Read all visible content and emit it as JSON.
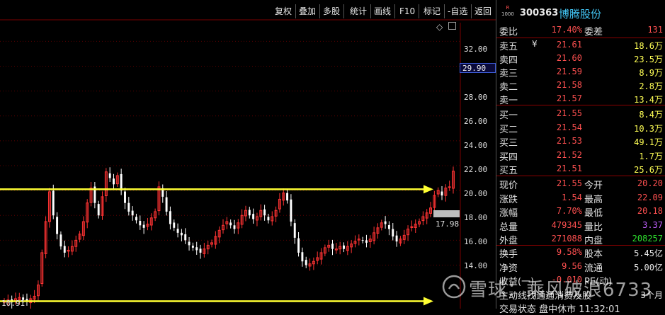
{
  "toolbar": {
    "buttons": [
      "复权",
      "叠加",
      "多股",
      "统计",
      "画线",
      "F10",
      "标记",
      "-自选",
      "返回"
    ]
  },
  "chart": {
    "y_axis_ticks": [
      "32.00",
      "30.00",
      "28.00",
      "26.00",
      "24.00",
      "22.00",
      "20.00",
      "18.00",
      "16.00",
      "14.00"
    ],
    "current_price_tag": "29.90",
    "low_marker": "17.98",
    "min_price_marker": "10.91",
    "colors": {
      "up": "#ff3333",
      "down": "#ffffff",
      "line": "#ffff33",
      "grid": "#5a0000"
    }
  },
  "chart_data": {
    "type": "candlestick",
    "ylim": [
      10.5,
      33.5
    ],
    "close": [
      11.1,
      11.2,
      11.0,
      11.3,
      11.4,
      11.2,
      11.1,
      11.3,
      11.5,
      12.4,
      15.0,
      17.5,
      19.9,
      18.0,
      16.5,
      15.5,
      15.0,
      15.2,
      15.5,
      16.0,
      16.5,
      17.5,
      19.0,
      20.2,
      19.0,
      18.0,
      19.5,
      21.5,
      21.0,
      20.5,
      21.2,
      20.0,
      19.0,
      18.3,
      18.0,
      17.6,
      17.2,
      17.0,
      17.3,
      17.8,
      18.3,
      20.3,
      19.5,
      18.3,
      17.3,
      17.0,
      16.6,
      16.4,
      16.0,
      15.6,
      15.4,
      15.2,
      15.0,
      15.3,
      15.6,
      15.8,
      16.3,
      16.8,
      17.2,
      17.5,
      17.2,
      16.9,
      17.4,
      18.0,
      18.4,
      18.0,
      17.7,
      17.9,
      18.4,
      18.0,
      17.6,
      17.9,
      18.4,
      19.3,
      19.8,
      19.2,
      17.5,
      16.2,
      15.0,
      14.3,
      14.0,
      14.1,
      14.3,
      14.6,
      15.0,
      15.4,
      15.6,
      15.3,
      15.3,
      15.5,
      15.3,
      15.5,
      15.7,
      15.9,
      16.1,
      16.0,
      15.8,
      16.1,
      16.6,
      17.0,
      17.4,
      17.3,
      16.9,
      16.3,
      15.9,
      16.1,
      16.4,
      16.9,
      17.1,
      17.3,
      17.5,
      17.9,
      18.2,
      18.6,
      19.6,
      20.0,
      19.6,
      20.2,
      20.3,
      21.55
    ],
    "min_marker": "10.91",
    "horizontal_lines": [
      20.1,
      11.1
    ]
  },
  "quote": {
    "badge_top": "R",
    "badge_bottom": "1000",
    "code": "300363",
    "name": "博腾股份",
    "weibi_label": "委比",
    "weibi_value": "17.40%",
    "weicha_label": "委差",
    "weicha_value": "131",
    "sells": [
      {
        "label": "卖五",
        "mark": "¥",
        "price": "21.61",
        "vol": "18.6万"
      },
      {
        "label": "卖四",
        "mark": "",
        "price": "21.60",
        "vol": "23.5万"
      },
      {
        "label": "卖三",
        "mark": "",
        "price": "21.59",
        "vol": "8.9万"
      },
      {
        "label": "卖二",
        "mark": "",
        "price": "21.58",
        "vol": "2.8万"
      },
      {
        "label": "卖一",
        "mark": "",
        "price": "21.57",
        "vol": "13.4万"
      }
    ],
    "buys": [
      {
        "label": "买一",
        "price": "21.55",
        "vol": "8.4万"
      },
      {
        "label": "买二",
        "price": "21.54",
        "vol": "10.3万"
      },
      {
        "label": "买三",
        "price": "21.53",
        "vol": "49.1万"
      },
      {
        "label": "买四",
        "price": "21.52",
        "vol": "1.7万"
      },
      {
        "label": "买五",
        "price": "21.51",
        "vol": "25.6万"
      }
    ],
    "stats": [
      {
        "l1": "现价",
        "v1": "21.55",
        "c1": "red",
        "l2": "今开",
        "v2": "20.20",
        "c2": "red"
      },
      {
        "l1": "涨跌",
        "v1": "1.54",
        "c1": "red",
        "l2": "最高",
        "v2": "22.09",
        "c2": "red"
      },
      {
        "l1": "涨幅",
        "v1": "7.70%",
        "c1": "red",
        "l2": "最低",
        "v2": "20.18",
        "c2": "red"
      },
      {
        "l1": "总量",
        "v1": "479345",
        "c1": "yel",
        "l2": "量比",
        "v2": "3.37",
        "c2": "pur"
      },
      {
        "l1": "外盘",
        "v1": "271088",
        "c1": "red",
        "l2": "内盘",
        "v2": "208257",
        "c2": "grn"
      }
    ],
    "stats2": [
      {
        "l1": "换手",
        "v1": "9.58%",
        "c1": "wht",
        "l2": "股本",
        "v2": "5.45亿",
        "c2": "wht"
      },
      {
        "l1": "净资",
        "v1": "9.56",
        "c1": "wht",
        "l2": "流通",
        "v2": "5.00亿",
        "c2": "wht"
      },
      {
        "l1": "收益(一)",
        "v1": "-0.010",
        "c1": "wht",
        "l2": "PE(动)",
        "v2": "",
        "c2": "wht"
      }
    ],
    "bottom_line": "主动线找通通消费及股",
    "bottom_month": "3个月",
    "status_line": "交易状态  盘中休市  11:32:01"
  },
  "watermark": {
    "text": "雪球：乘风破浪6733"
  }
}
